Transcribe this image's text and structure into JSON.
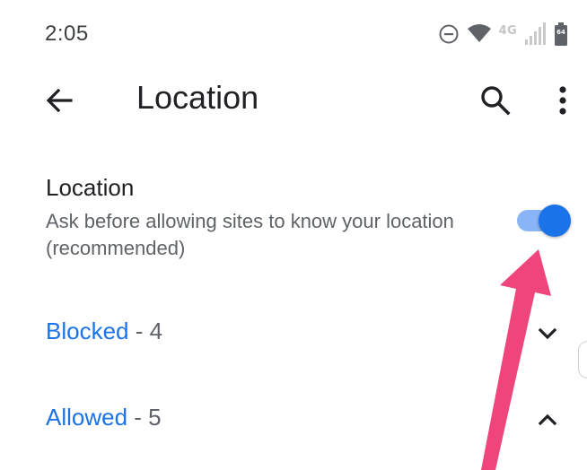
{
  "status_bar": {
    "time": "2:05",
    "network_label": "4G",
    "battery_level": "64",
    "icons": [
      "do-not-disturb-icon",
      "wifi-icon",
      "network-4g-icon",
      "signal-icon",
      "battery-icon"
    ]
  },
  "app_bar": {
    "title": "Location",
    "back_icon": "arrow-back-icon",
    "search_icon": "search-icon",
    "more_icon": "more-vert-icon"
  },
  "setting": {
    "title": "Location",
    "summary": "Ask before allowing sites to know your location (recommended)",
    "toggle_on": true
  },
  "sections": [
    {
      "name": "Blocked",
      "separator": " - ",
      "count": "4",
      "expanded": false,
      "chevron_icon": "chevron-down-icon"
    },
    {
      "name": "Allowed",
      "separator": " - ",
      "count": "5",
      "expanded": true,
      "chevron_icon": "chevron-up-icon"
    }
  ],
  "colors": {
    "accent": "#1a73e8",
    "toggle_track": "#8ab4f8",
    "toggle_thumb": "#1a73e8",
    "text_primary": "#202124",
    "text_secondary": "#5f6368",
    "annotation_arrow": "#f0457a"
  }
}
